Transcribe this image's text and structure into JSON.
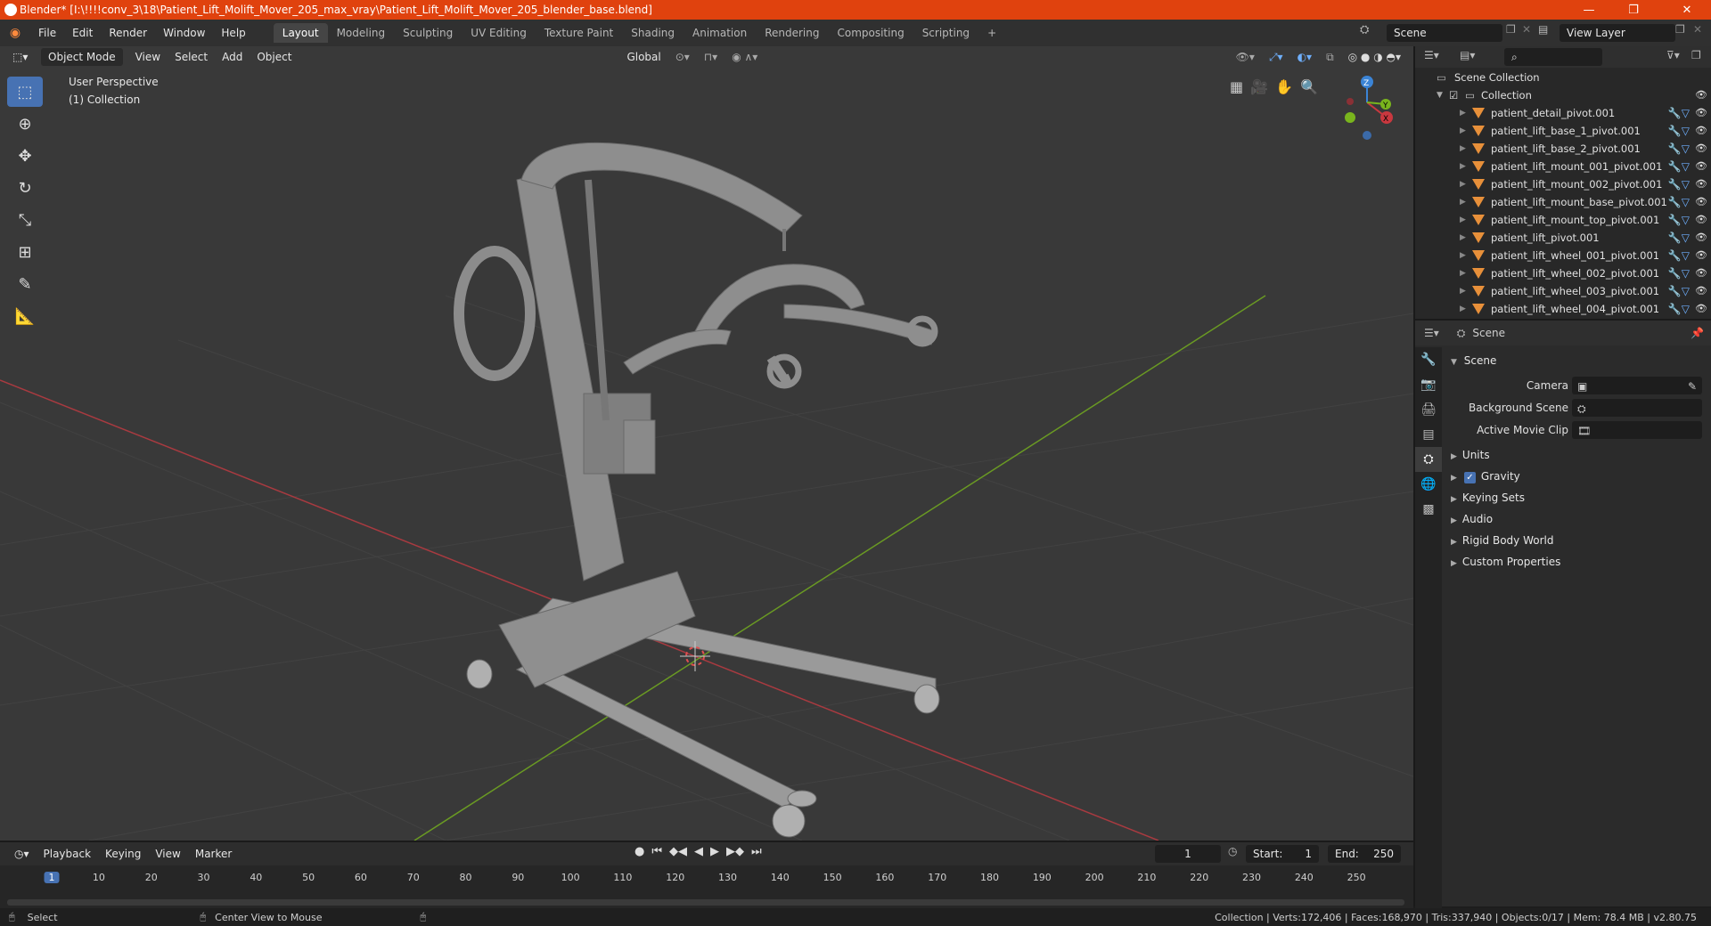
{
  "window": {
    "title": "Blender* [I:\\!!!!conv_3\\18\\Patient_Lift_Molift_Mover_205_max_vray\\Patient_Lift_Molift_Mover_205_blender_base.blend]",
    "minimize": "—",
    "maximize": "❐",
    "close": "✕"
  },
  "menubar": {
    "items": [
      "File",
      "Edit",
      "Render",
      "Window",
      "Help"
    ],
    "workspaces": [
      "Layout",
      "Modeling",
      "Sculpting",
      "UV Editing",
      "Texture Paint",
      "Shading",
      "Animation",
      "Rendering",
      "Compositing",
      "Scripting"
    ],
    "add_workspace": "+",
    "scene": "Scene",
    "view_layer": "View Layer"
  },
  "viewport": {
    "mode": "Object Mode",
    "menus": [
      "View",
      "Select",
      "Add",
      "Object"
    ],
    "orientation": "Global",
    "perspective_label": "User Perspective",
    "collection_label": "(1) Collection",
    "gizmo_axes": {
      "z": "Z",
      "y": "Y",
      "x": "X"
    }
  },
  "outliner": {
    "search_placeholder": "",
    "scene_collection": "Scene Collection",
    "collection": "Collection",
    "objects": [
      "patient_detail_pivot.001",
      "patient_lift_base_1_pivot.001",
      "patient_lift_base_2_pivot.001",
      "patient_lift_mount_001_pivot.001",
      "patient_lift_mount_002_pivot.001",
      "patient_lift_mount_base_pivot.001",
      "patient_lift_mount_top_pivot.001",
      "patient_lift_pivot.001",
      "patient_lift_wheel_001_pivot.001",
      "patient_lift_wheel_002_pivot.001",
      "patient_lift_wheel_003_pivot.001",
      "patient_lift_wheel_004_pivot.001"
    ]
  },
  "properties": {
    "header": "Scene",
    "section": "Scene",
    "camera_label": "Camera",
    "background_scene_label": "Background Scene",
    "active_movie_clip_label": "Active Movie Clip",
    "panels": [
      "Units",
      "Gravity",
      "Keying Sets",
      "Audio",
      "Rigid Body World",
      "Custom Properties"
    ],
    "gravity_checked": true
  },
  "timeline": {
    "menus": [
      "Playback",
      "Keying",
      "View",
      "Marker"
    ],
    "current_frame": "1",
    "start_label": "Start:",
    "start": "1",
    "end_label": "End:",
    "end": "250",
    "ticks": [
      "1",
      "10",
      "20",
      "30",
      "40",
      "50",
      "60",
      "70",
      "80",
      "90",
      "100",
      "110",
      "120",
      "130",
      "140",
      "150",
      "160",
      "170",
      "180",
      "190",
      "200",
      "210",
      "220",
      "230",
      "240",
      "250"
    ]
  },
  "statusbar": {
    "select": "Select",
    "center_view": "Center View to Mouse",
    "stats": "Collection | Verts:172,406 | Faces:168,970 | Tris:337,940 | Objects:0/17 | Mem: 78.4 MB | v2.80.75"
  },
  "colors": {
    "title_bar": "#e0420e",
    "accent": "#4772b3",
    "object_icon": "#e8903a",
    "x_axis": "#c9383f",
    "y_axis": "#79b51d",
    "z_axis": "#3b84d6"
  }
}
